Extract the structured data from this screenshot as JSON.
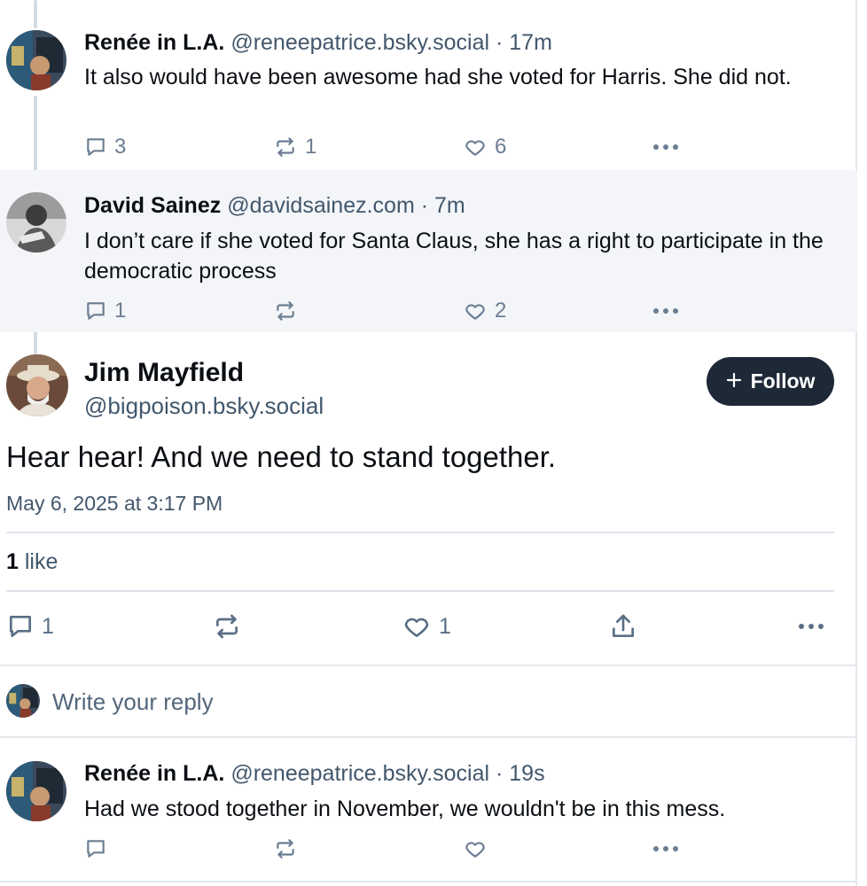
{
  "thread": [
    {
      "name": "Renée in L.A.",
      "handle": "@reneepatrice.bsky.social",
      "separator": "·",
      "time": "17m",
      "text": "It also would have been awesome had she voted for Harris. She did not.",
      "reply_count": "3",
      "repost_count": "1",
      "like_count": "6"
    },
    {
      "name": "David Sainez",
      "handle": "@davidsainez.com",
      "separator": "·",
      "time": "7m",
      "text": "I don’t care if she voted for Santa Claus, she has a right to participate in the democratic process",
      "reply_count": "1",
      "repost_count": "",
      "like_count": "2"
    }
  ],
  "focal": {
    "name": "Jim Mayfield",
    "handle": "@bigpoison.bsky.social",
    "follow_label": "Follow",
    "text": "Hear hear! And we need to stand together.",
    "date": "May 6, 2025 at 3:17 PM",
    "likes_count": "1",
    "likes_word": "like",
    "reply_count": "1",
    "repost_count": "",
    "like_count": "1"
  },
  "reply_box": {
    "placeholder": "Write your reply"
  },
  "replies": [
    {
      "name": "Renée in L.A.",
      "handle": "@reneepatrice.bsky.social",
      "separator": "·",
      "time": "19s",
      "text": "Had we stood together in November, we wouldn't be in this mess.",
      "reply_count": "",
      "repost_count": "",
      "like_count": ""
    }
  ],
  "icons": {
    "reply": "speech-bubble-icon",
    "repost": "repost-arrows-icon",
    "like": "heart-icon",
    "share": "share-upload-icon",
    "more": "ellipsis-icon",
    "follow": "plus-icon"
  },
  "colors": {
    "follow_button": "#1e2937",
    "highlight_background": "#f3f5f8",
    "muted_text": "#42576c",
    "thread_line": "#d4dbe2"
  }
}
